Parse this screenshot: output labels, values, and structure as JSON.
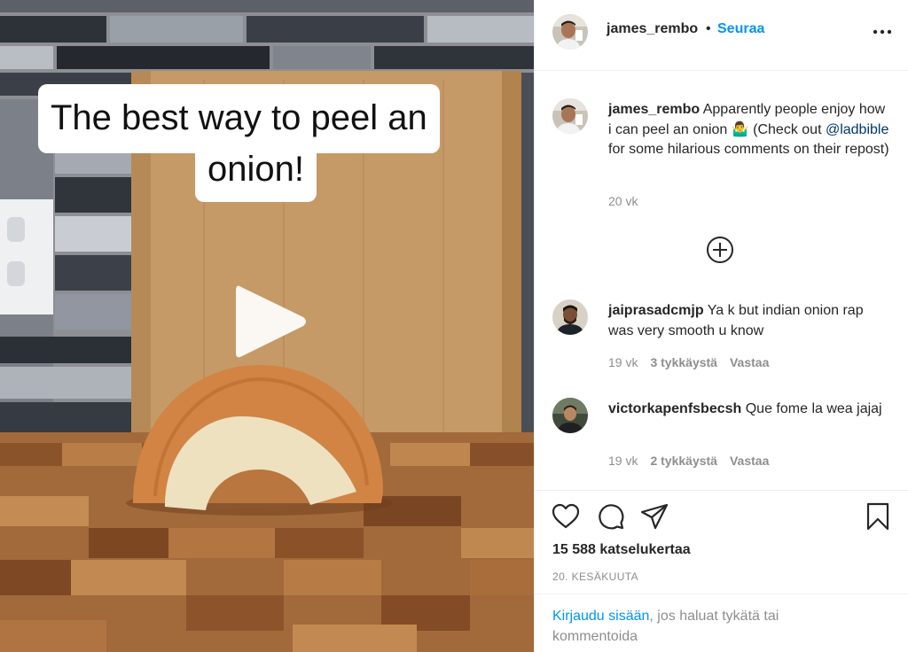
{
  "video": {
    "caption_line1": "The best way to peel an",
    "caption_line2": "onion!",
    "play_icon": "play-icon"
  },
  "header": {
    "username": "james_rembo",
    "separator": "•",
    "follow_label": "Seuraa",
    "more_icon": "more-horizontal-icon"
  },
  "post_caption": {
    "username": "james_rembo",
    "text": "Apparently people enjoy how i can peel an onion 🤷‍♂️ (Check out ",
    "mention": "@ladbible",
    "text_after": " for some hilarious comments on their repost)",
    "age": "20 vk"
  },
  "load_more_icon": "plus-circle-icon",
  "comments": [
    {
      "username": "jaiprasadcmjp",
      "text": "Ya k but indian onion rap was very smooth u know",
      "age": "19 vk",
      "likes": "3 tykkäystä",
      "reply": "Vastaa"
    },
    {
      "username": "victorkapenfsbecsh",
      "text": "Que fome la wea jajaj",
      "age": "19 vk",
      "likes": "2 tykkäystä",
      "reply": "Vastaa"
    }
  ],
  "actions": {
    "icons": [
      "heart-icon",
      "comment-icon",
      "share-icon",
      "bookmark-icon"
    ],
    "views": "15 588 katselukertaa",
    "date": "20. KESÄKUUTA"
  },
  "login_prompt": {
    "link": "Kirjaudu sisään",
    "text": ", jos haluat tykätä tai kommentoida"
  },
  "colors": {
    "accent": "#0095f6",
    "text": "#262626",
    "muted": "#8e8e8e",
    "mention": "#00376b"
  }
}
